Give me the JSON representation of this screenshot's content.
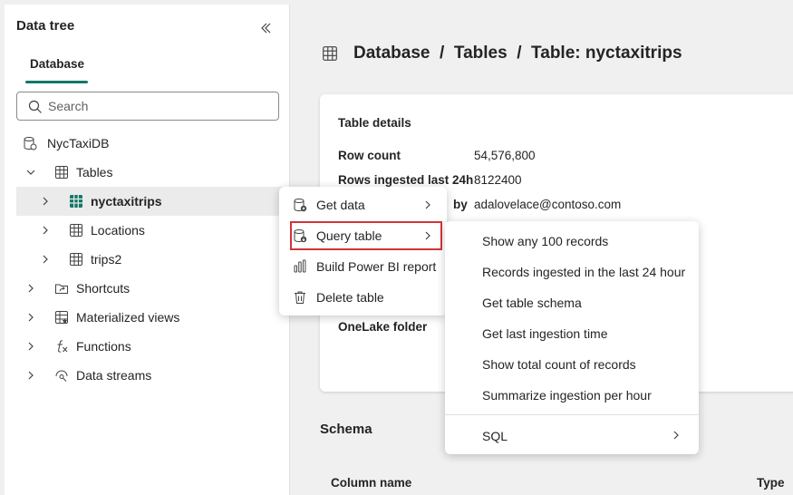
{
  "left_panel": {
    "title": "Data tree",
    "tab": "Database",
    "search": {
      "placeholder": "Search"
    },
    "tree": {
      "db": "NycTaxiDB",
      "tables": "Tables",
      "nyctaxitrips": "nyctaxitrips",
      "locations": "Locations",
      "trips2": "trips2",
      "shortcuts": "Shortcuts",
      "materialized_views": "Materialized views",
      "functions": "Functions",
      "data_streams": "Data streams"
    }
  },
  "main": {
    "breadcrumb": "Database  /  Tables  /  Table: nyctaxitrips",
    "card": {
      "title": "Table details",
      "row_count_label": "Row count",
      "row_count_value": "54,576,800",
      "rows_ingested_label": "Rows ingested last 24h",
      "rows_ingested_value": "8122400",
      "created_by_label": "by",
      "created_by_value": "adalovelace@contoso.com",
      "onelake_label": "OneLake folder"
    },
    "schema_title": "Schema",
    "columns": {
      "name": "Column name",
      "type": "Type"
    }
  },
  "context_menu": {
    "get_data": "Get data",
    "query_table": "Query table",
    "build_report": "Build Power BI report",
    "delete_table": "Delete table"
  },
  "submenu": {
    "items": [
      "Show any 100 records",
      "Records ingested in the last 24 hour",
      "Get table schema",
      "Get last ingestion time",
      "Show total count of records",
      "Summarize ingestion per hour"
    ],
    "sql": "SQL"
  },
  "colors": {
    "accent": "#117865",
    "highlight": "#d13438",
    "grid_green": "#117865"
  }
}
